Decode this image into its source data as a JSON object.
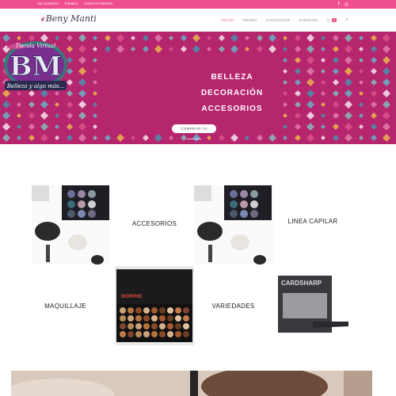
{
  "topbar": {
    "links": [
      "MI CUENTA",
      "TIENDA",
      "CONTACTENOS"
    ],
    "social": [
      "f",
      "◎"
    ]
  },
  "header": {
    "logo_text": "Beny Manti",
    "nav": [
      {
        "label": "INICIO",
        "active": true
      },
      {
        "label": "TIENDA",
        "active": false
      },
      {
        "label": "CATALOGOS",
        "active": false
      },
      {
        "label": "EVENTOS",
        "active": false
      }
    ],
    "cart_count": "0"
  },
  "hero": {
    "logo_top": "Tienda Virtual",
    "logo_letters": "BM",
    "logo_tagline": "Belleza y algo más...",
    "words": [
      "BELLEZA",
      "DECORACIÓN",
      "ACCESORIOS"
    ],
    "button": "COMPRAR YA",
    "bg_color": "#b5266e"
  },
  "categories": [
    {
      "label": "ACCESORIOS"
    },
    {
      "label": "LINEA CAPILAR"
    },
    {
      "label": "MAQUILLAJE"
    },
    {
      "label": "VARIEDADES"
    }
  ],
  "products": {
    "morphe_brand": "MORPHE",
    "cardsharp_title": "CARDSHARP"
  },
  "colors": {
    "accent": "#f04f8e"
  }
}
